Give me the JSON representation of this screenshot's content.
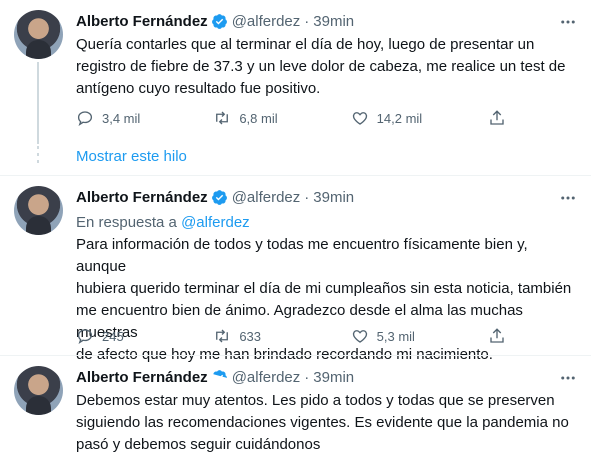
{
  "tweets": [
    {
      "name": "Alberto Fernández",
      "handle": "@alferdez",
      "separator": "·",
      "time": "39min",
      "reply_to_prefix": "",
      "reply_to_handle": "",
      "text": "Quería contarles que al terminar el día de hoy, luego de presentar un\nregistro de fiebre de 37.3 y un leve dolor de cabeza, me realice un test de\nantígeno cuyo resultado fue positivo.",
      "replies": "3,4 mil",
      "retweets": "6,8 mil",
      "likes": "14,2 mil"
    },
    {
      "name": "Alberto Fernández",
      "handle": "@alferdez",
      "separator": "·",
      "time": "39min",
      "reply_to_prefix": "En respuesta a ",
      "reply_to_handle": "@alferdez",
      "text": "Para información de todos y todas me encuentro físicamente bien y, aunque\nhubiera querido terminar el día de mi cumpleaños sin esta noticia, también\nme encuentro bien de ánimo. Agradezco desde el alma las muchas muestras\nde afecto que hoy me han brindado recordando mi nacimiento.",
      "replies": "245",
      "retweets": "633",
      "likes": "5,3 mil"
    },
    {
      "name": "Alberto Fernández",
      "handle": "@alferdez",
      "separator": "·",
      "time": "39min",
      "text": "Debemos estar muy atentos. Les pido a todos y todas que se preserven\nsiguiendo las recomendaciones vigentes. Es evidente que la pandemia no\npasó y debemos seguir cuidándonos"
    }
  ],
  "show_thread_label": "Mostrar este hilo",
  "colors": {
    "accent": "#1d9bf0",
    "secondary_text": "#536471",
    "primary_text": "#0f1419"
  },
  "icons": [
    "verified-badge-icon",
    "more-options-icon",
    "reply-icon",
    "retweet-icon",
    "like-icon",
    "share-icon"
  ]
}
